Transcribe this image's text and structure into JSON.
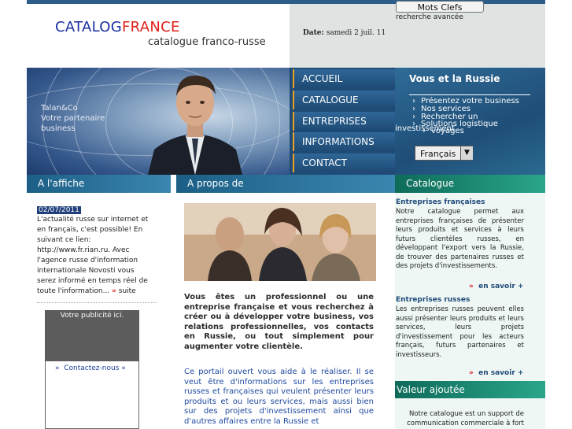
{
  "header": {
    "logo_part1": "CATALOG",
    "logo_part2": "FRANCE",
    "tagline": "catalogue franco-russe",
    "date_label": "Date:",
    "date_value": "samedi 2 juil. 11",
    "keywords_button": "Mots Clefs",
    "advanced_search": "recherche avancée"
  },
  "banner": {
    "company_lines": [
      "Talan&Co",
      "Votre partenaire",
      "business"
    ]
  },
  "nav": {
    "items": [
      "ACCUEIL",
      "CATALOGUE",
      "ENTREPRISES",
      "INFORMATIONS",
      "CONTACT"
    ]
  },
  "russie": {
    "title": "Vous et la Russie",
    "items": [
      "Présentez votre business",
      "Nos services",
      "Rechercher un",
      "Solutions logistique",
      "voyages"
    ],
    "overlap_text": "investissement",
    "language": "Français"
  },
  "sections": {
    "affiche": "A l'affiche",
    "apropos": "A propos de",
    "catalogue": "Catalogue"
  },
  "news": {
    "date": "02/07/2011",
    "text": "L'actualité russe sur internet et en français, c'est possible! En suivant ce lien: http://www.fr.rian.ru. Avec l'agence russe d'information internationale Novosti vous serez informé en temps réel de toute l'information...",
    "more_arrow": "»",
    "more": "suite"
  },
  "pub": {
    "text": "Votre publicité ici.",
    "contact_arrow": "»",
    "contact_link": "Contactez-nous",
    "contact_tail": "«"
  },
  "about": {
    "intro": "Vous êtes un professionnel ou une entreprise française et vous recherchez à créer ou à développer votre business, vos relations professionnelles, vos contacts en Russie, ou tout simplement pour augmenter votre clientèle.",
    "portal": "Ce portail ouvert vous aide à le réaliser. Il se veut être d'informations sur les entreprises russes et françaises qui veulent présenter leurs produits et ou leurs services, mais aussi bien sur des projets d'investissement ainsi que d'autres affaires entre la Russie et"
  },
  "catalogue": {
    "fr_title": "Entreprises françaises",
    "fr_text": "Notre catalogue permet aux entreprises françaises de présenter leurs produits et services à leurs futurs clientèles russes, en développant l'export vers la Russie, de trouver des partenaires russes et des projets d'investissements.",
    "ru_title": "Entreprises russes",
    "ru_text": "Les entreprises russes peuvent elles aussi présenter leurs produits et leurs services, leurs projets d'investissement pour les acteurs français, futurs partenaires et investisseurs.",
    "more_arrow": "»",
    "more": "en savoir +",
    "valeur_title": "Valeur ajoutée",
    "valeur_text": "Notre catalogue est un support de communication commerciale à fort"
  },
  "colors": {
    "nav_bg": "#1f4c77",
    "accent_orange": "#f0a020",
    "catalogue_green": "#0e6b5a",
    "logo_red": "#e0201a",
    "logo_blue": "#1a2fa0"
  }
}
